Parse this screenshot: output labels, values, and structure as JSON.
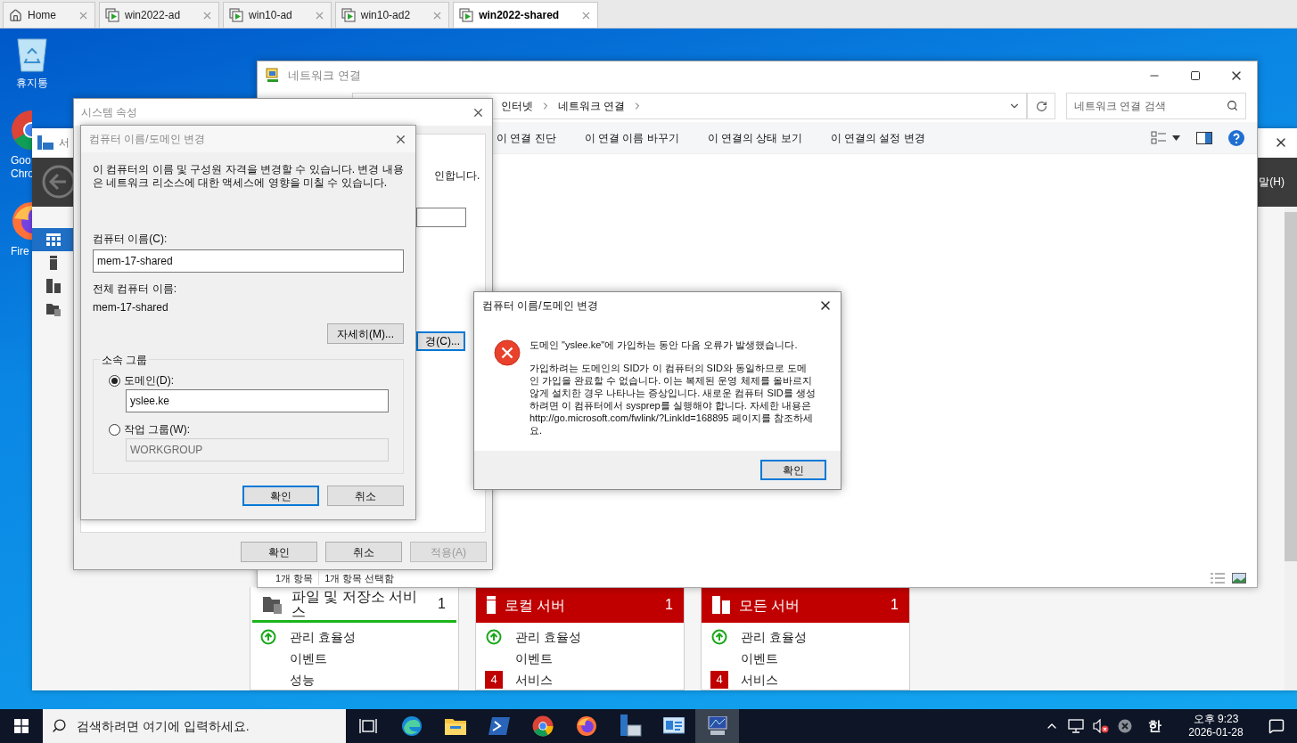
{
  "vm_tabs": [
    {
      "label": "Home",
      "kind": "home",
      "selected": false
    },
    {
      "label": "win2022-ad",
      "kind": "vm",
      "selected": false
    },
    {
      "label": "win10-ad",
      "kind": "vm",
      "selected": false
    },
    {
      "label": "win10-ad2",
      "kind": "vm",
      "selected": false
    },
    {
      "label": "win2022-shared",
      "kind": "vm",
      "selected": true
    }
  ],
  "desktop_icons": [
    {
      "kind": "recycle",
      "lines": [
        "휴지통"
      ]
    },
    {
      "kind": "chrome",
      "lines": [
        "Goo",
        "Chro"
      ]
    },
    {
      "kind": "firefox",
      "lines": [
        "Fire"
      ]
    }
  ],
  "server_manager": {
    "title": "서",
    "menu_partial": "말(H)",
    "nav": [
      {
        "kind": "dashboard",
        "selected": true
      },
      {
        "kind": "local",
        "selected": false
      },
      {
        "kind": "all",
        "selected": false
      },
      {
        "kind": "files",
        "selected": false
      }
    ],
    "tiles": [
      {
        "kind": "files",
        "title": "파일 및 저장소 서비스",
        "count": "1",
        "alert": false,
        "rows": [
          {
            "label": "관리 효율성",
            "kind": "ok"
          },
          {
            "label": "이벤트",
            "kind": "plain"
          },
          {
            "label": "성능",
            "kind": "plain"
          }
        ]
      },
      {
        "kind": "local",
        "title": "로컬 서버",
        "count": "1",
        "alert": true,
        "rows": [
          {
            "label": "관리 효율성",
            "kind": "ok"
          },
          {
            "label": "이벤트",
            "kind": "plain"
          },
          {
            "label": "서비스",
            "kind": "alert",
            "badge": "4"
          }
        ]
      },
      {
        "kind": "all",
        "title": "모든 서버",
        "count": "1",
        "alert": true,
        "rows": [
          {
            "label": "관리 효율성",
            "kind": "ok"
          },
          {
            "label": "이벤트",
            "kind": "plain"
          },
          {
            "label": "서비스",
            "kind": "alert",
            "badge": "4"
          }
        ]
      }
    ]
  },
  "network_window": {
    "title": "네트워크 연결",
    "breadcrumb": [
      "인터넷",
      "네트워크 연결"
    ],
    "search": {
      "placeholder": "네트워크 연결 검색"
    },
    "commands": [
      "이 연결 진단",
      "이 연결 이름 바꾸기",
      "이 연결의 상태 보기",
      "이 연결의 설정 변경"
    ],
    "status_bar": [
      "1개 항목",
      "1개 항목 선택함"
    ]
  },
  "system_properties": {
    "title": "시스템 속성",
    "behind_text": "인합니다.",
    "behind_button": "경(C)...",
    "buttons": [
      {
        "label": "확인",
        "disabled": false
      },
      {
        "label": "취소",
        "disabled": false
      },
      {
        "label": "적용(A)",
        "disabled": true
      }
    ]
  },
  "change_dialog": {
    "title": "컴퓨터 이름/도메인 변경",
    "description": "이 컴퓨터의 이름 및 구성원 자격을 변경할 수 있습니다. 변경 내용은 네트워크 리소스에 대한 액세스에 영향을 미칠 수 있습니다.",
    "computer_name_label": "컴퓨터 이름(C):",
    "computer_name": "mem-17-shared",
    "full_name_label": "전체 컴퓨터 이름:",
    "full_name": "mem-17-shared",
    "more_button": "자세히(M)...",
    "group_title": "소속 그룹",
    "options": [
      {
        "label": "도메인(D):",
        "selected": true,
        "value": "yslee.ke"
      },
      {
        "label": "작업 그룹(W):",
        "selected": false,
        "value": "WORKGROUP"
      }
    ],
    "buttons": [
      {
        "label": "확인",
        "default": true
      },
      {
        "label": "취소",
        "default": false
      }
    ]
  },
  "error_dialog": {
    "title": "컴퓨터 이름/도메인 변경",
    "message": "도메인 \"yslee.ke\"에 가입하는 동안 다음 오류가 발생했습니다.",
    "details": "가입하려는 도메인의 SID가 이 컴퓨터의 SID와 동일하므로 도메인 가입을 완료할 수 없습니다. 이는 복제된 운영 체제를 올바르지 않게 설치한 경우 나타나는 증상입니다. 새로운 컴퓨터 SID를 생성하려면 이 컴퓨터에서 sysprep를 실행해야 합니다. 자세한 내용은 http://go.microsoft.com/fwlink/?LinkId=168895 페이지를 참조하세요.",
    "buttons": [
      {
        "label": "확인",
        "default": true
      }
    ]
  },
  "taskbar": {
    "search": {
      "placeholder": "검색하려면 여기에 입력하세요."
    },
    "apps": [
      {
        "kind": "taskview",
        "selected": false
      },
      {
        "kind": "edge",
        "selected": false
      },
      {
        "kind": "folder",
        "selected": false
      },
      {
        "kind": "terminal",
        "selected": false
      },
      {
        "kind": "chrome",
        "selected": false
      },
      {
        "kind": "firefox",
        "selected": false
      },
      {
        "kind": "server",
        "selected": false
      },
      {
        "kind": "panel",
        "selected": false
      },
      {
        "kind": "remote",
        "selected": true
      }
    ],
    "ime": "한",
    "time": "오후 9:23",
    "date": "2026-01-28"
  }
}
